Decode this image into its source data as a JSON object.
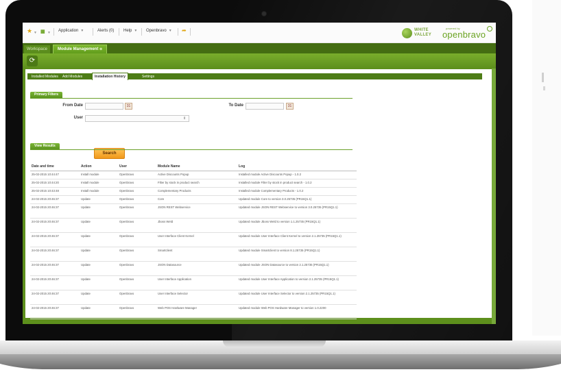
{
  "app": {
    "menu": {
      "application_label": "Application",
      "alerts_label": "Alerts (0)",
      "help_label": "Help",
      "user_label": "Openbravo"
    },
    "logos": {
      "white_valley_line1": "WHITE",
      "white_valley_line2": "VALLEY",
      "powered_by": "powered by",
      "openbravo": "openbravo"
    },
    "window_tabs": [
      {
        "label": "Workspace"
      },
      {
        "label": "Module Management"
      }
    ],
    "toolbar": {
      "refresh_icon": "refresh-icon"
    }
  },
  "subtabs": [
    {
      "label": "Installed Modules"
    },
    {
      "label": "Add Modules"
    },
    {
      "label": "Installation History"
    },
    {
      "label": "Settings"
    }
  ],
  "filters": {
    "section_title": "Primary Filters",
    "from_date_label": "From Date",
    "to_date_label": "To Date",
    "user_label": "User",
    "from_date_value": "",
    "to_date_value": "",
    "user_value": "",
    "search_button": "Search"
  },
  "results": {
    "section_title": "View Results",
    "columns": [
      "Date and time",
      "Action",
      "User",
      "Module Name",
      "Log"
    ],
    "rows": [
      [
        "25-02-2015 10:44:47",
        "Install module",
        "Openbravo",
        "Active Discounts Popup",
        "Installed module Active Discounts Popup - 1.0.2"
      ],
      [
        "25-02-2015 10:44:20",
        "Install module",
        "Openbravo",
        "Filter by stock in product search",
        "Installed module Filter by stock in product search - 1.0.2"
      ],
      [
        "25-02-2015 10:43:48",
        "Install module",
        "Openbravo",
        "Complementary Products",
        "Installed module Complementary Products - 1.0.2"
      ],
      [
        "24-02-2015 20:46:37",
        "Update",
        "Openbravo",
        "Core",
        "Updated module Core to version 3.0.25735 (PR15Q1.1)"
      ],
      [
        "24-02-2015 20:46:37",
        "Update",
        "Openbravo",
        "JSON REST Webservice",
        "Updated module JSON REST Webservice to version 3.0.25735 (PR15Q1.1)"
      ],
      [
        "24-02-2015 20:46:37",
        "Update",
        "Openbravo",
        "Jboss Weld",
        "Updated module Jboss Weld to version 1.1.25735 (PR15Q1.1)"
      ],
      [
        "24-02-2015 20:46:37",
        "Update",
        "Openbravo",
        "User Interface Client Kernel",
        "Updated module User Interface Client Kernel to version 2.1.25735 (PR15Q1.1)"
      ],
      [
        "24-02-2015 20:46:37",
        "Update",
        "Openbravo",
        "Smartclient",
        "Updated module Smartclient to version 8.1.25735 (PR15Q1.1)"
      ],
      [
        "24-02-2015 20:46:37",
        "Update",
        "Openbravo",
        "JSON Datasource",
        "Updated module JSON Datasource to version 2.1.25735 (PR15Q1.1)"
      ],
      [
        "24-02-2015 20:46:37",
        "Update",
        "Openbravo",
        "User Interface Application",
        "Updated module User Interface Application to version 2.1.25735 (PR15Q1.1)"
      ],
      [
        "24-02-2015 20:46:37",
        "Update",
        "Openbravo",
        "User Interface Selector",
        "Updated module User Interface Selector to version 2.1.25735 (PR15Q1.1)"
      ],
      [
        "24-02-2015 20:46:37",
        "Update",
        "Openbravo",
        "Web POS Hardware Manager",
        "Updated module Web POS Hardware Manager to version 1.0.2200"
      ]
    ]
  },
  "colors": {
    "brand_green": "#5d8f1c",
    "dark_green": "#446d12",
    "search_orange": "#f1981a"
  }
}
